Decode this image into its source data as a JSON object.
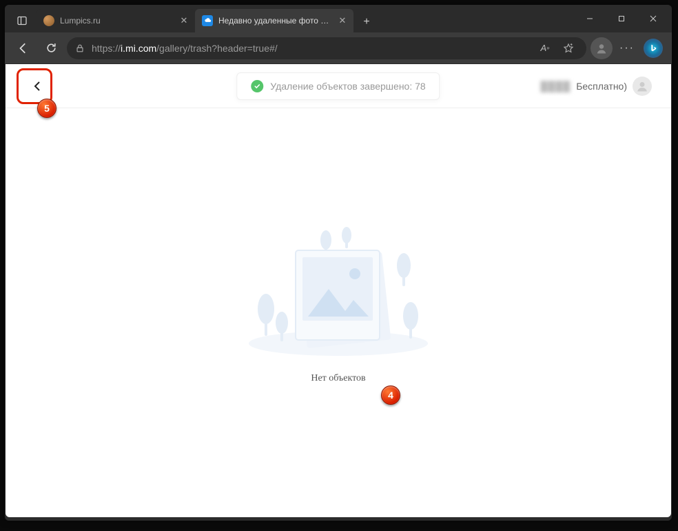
{
  "browser": {
    "tabs": [
      {
        "title": "Lumpics.ru",
        "active": false,
        "favicon": "orange"
      },
      {
        "title": "Недавно удаленные фото и вид",
        "active": true,
        "favicon": "blue-cloud"
      }
    ],
    "url": {
      "scheme": "https://",
      "host": "i.mi.com",
      "path": "/gallery/trash?header=true#/"
    }
  },
  "page": {
    "status_message": "Удаление объектов завершено: 78",
    "user_plan_blur": "████",
    "user_plan_suffix": "Бесплатно)",
    "empty_text": "Нет объектов"
  },
  "annotations": {
    "badge4": "4",
    "badge5": "5"
  }
}
